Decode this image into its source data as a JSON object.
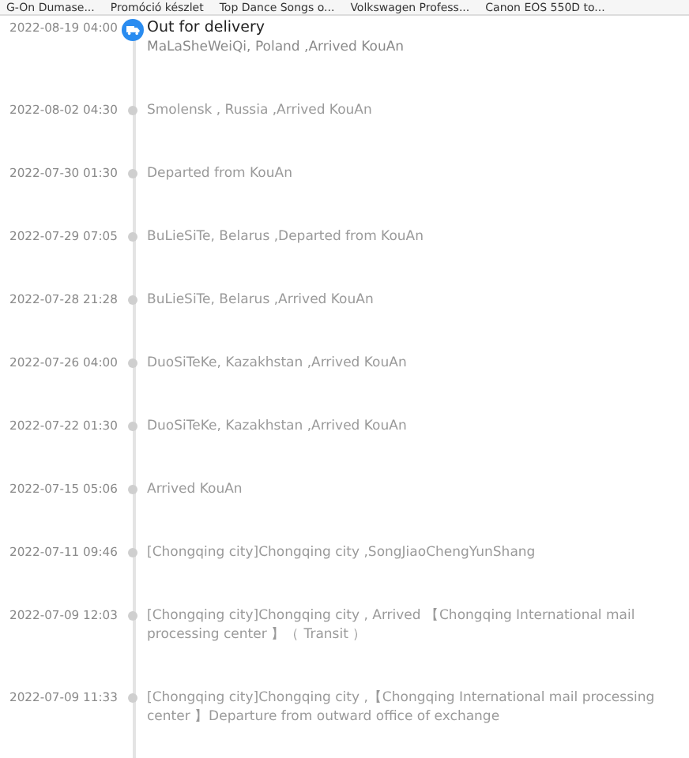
{
  "bookmarks": [
    "G-On Dumase...",
    "Promóció készlet",
    "Top Dance Songs o...",
    "Volkswagen Profess...",
    "Canon EOS 550D to..."
  ],
  "events": [
    {
      "time": "2022-08-19 04:00",
      "title": "Out for delivery",
      "detail": "MaLaSheWeiQi, Poland ,Arrived KouAn",
      "current": true
    },
    {
      "time": "2022-08-02 04:30",
      "detail": "Smolensk , Russia ,Arrived KouAn",
      "current": false
    },
    {
      "time": "2022-07-30 01:30",
      "detail": "Departed from KouAn",
      "current": false
    },
    {
      "time": "2022-07-29 07:05",
      "detail": "BuLieSiTe, Belarus ,Departed from KouAn",
      "current": false
    },
    {
      "time": "2022-07-28 21:28",
      "detail": "BuLieSiTe, Belarus ,Arrived KouAn",
      "current": false
    },
    {
      "time": "2022-07-26 04:00",
      "detail": "DuoSiTeKe, Kazakhstan ,Arrived KouAn",
      "current": false
    },
    {
      "time": "2022-07-22 01:30",
      "detail": "DuoSiTeKe, Kazakhstan ,Arrived KouAn",
      "current": false
    },
    {
      "time": "2022-07-15 05:06",
      "detail": "Arrived KouAn",
      "current": false
    },
    {
      "time": "2022-07-11 09:46",
      "detail": "[Chongqing city]Chongqing city ,SongJiaoChengYunShang",
      "current": false
    },
    {
      "time": "2022-07-09 12:03",
      "detail": "[Chongqing city]Chongqing city , Arrived 【Chongqing International mail processing center 】（ Transit ）",
      "current": false
    },
    {
      "time": "2022-07-09 11:33",
      "detail": "[Chongqing city]Chongqing city ,【Chongqing International mail processing center 】Departure from outward office of exchange",
      "current": false
    }
  ]
}
